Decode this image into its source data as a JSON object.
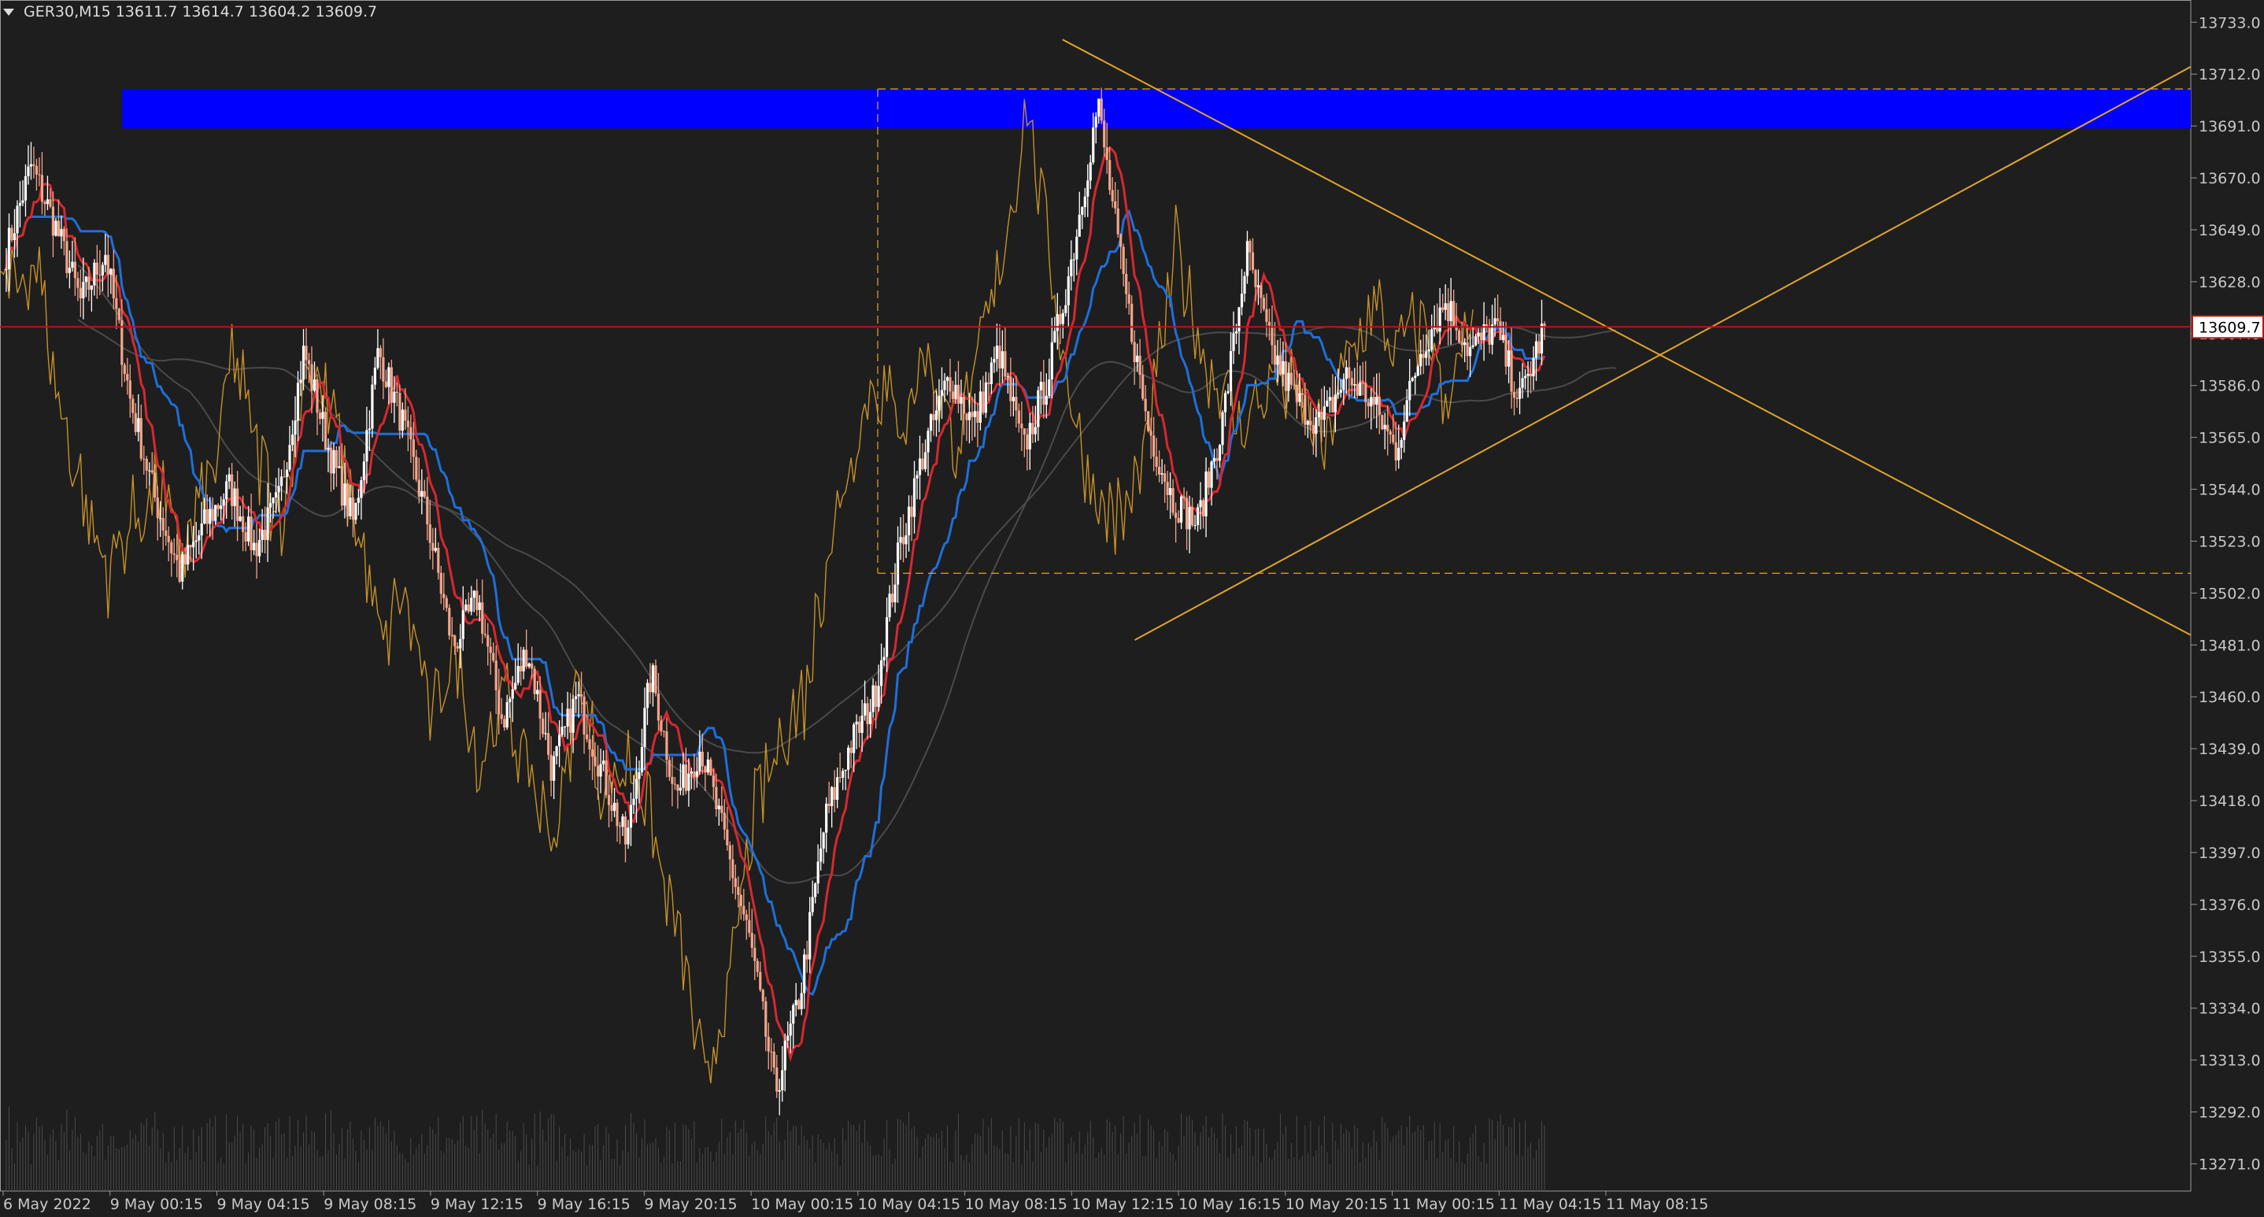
{
  "header": {
    "symbol_timeframe": "GER30,M15",
    "ohlc": "13611.7 13614.7 13604.2 13609.7"
  },
  "price_label": "13609.7",
  "colors": {
    "background": "#1e1e1e",
    "bull_candle": "#ffffff",
    "bear_candle": "#f4a58a",
    "zone": "#0000ff",
    "trendline": "#e2a52a",
    "tenkan": "#d6282f",
    "kijun": "#1e6fd9",
    "cloud_lines": "#4a4a4a",
    "chikou": "#e2a52a",
    "price_line": "#b01818",
    "grid_text": "#c8c8c8"
  },
  "chart_data": {
    "type": "candlestick",
    "symbol": "GER30",
    "timeframe": "M15",
    "ylim": [
      13260,
      13742
    ],
    "y_ticks": [
      13733.0,
      13712.0,
      13691.0,
      13670.0,
      13649.0,
      13628.0,
      13607.0,
      13586.0,
      13565.0,
      13544.0,
      13523.0,
      13502.0,
      13481.0,
      13460.0,
      13439.0,
      13418.0,
      13397.0,
      13376.0,
      13355.0,
      13334.0,
      13313.0,
      13292.0,
      13271.0
    ],
    "x_ticks": [
      "6 May 2022",
      "9 May 00:15",
      "9 May 04:15",
      "9 May 08:15",
      "9 May 12:15",
      "9 May 16:15",
      "9 May 20:15",
      "10 May 00:15",
      "10 May 04:15",
      "10 May 08:15",
      "10 May 12:15",
      "10 May 16:15",
      "10 May 20:15",
      "11 May 00:15",
      "11 May 04:15",
      "11 May 08:15"
    ],
    "last_price": 13609.7,
    "close_path": [
      13640,
      13675,
      13650,
      13620,
      13640,
      13580,
      13540,
      13510,
      13530,
      13545,
      13520,
      13540,
      13600,
      13560,
      13530,
      13600,
      13570,
      13530,
      13480,
      13500,
      13450,
      13480,
      13430,
      13460,
      13430,
      13400,
      13470,
      13420,
      13440,
      13400,
      13360,
      13300,
      13340,
      13410,
      13440,
      13460,
      13520,
      13560,
      13590,
      13570,
      13600,
      13560,
      13590,
      13640,
      13700,
      13630,
      13570,
      13540,
      13530,
      13570,
      13640,
      13600,
      13580,
      13570,
      13590,
      13580,
      13560,
      13600,
      13620,
      13600,
      13610,
      13580,
      13610
    ],
    "zones": [
      {
        "y_top": 13706,
        "y_bottom": 13690
      }
    ],
    "horizontal_levels": [
      13706,
      13510
    ],
    "trendlines": [
      {
        "from": [
          0.485,
          13726
        ],
        "to": [
          1.0,
          13485
        ]
      },
      {
        "from": [
          0.518,
          13483
        ],
        "to": [
          1.0,
          13715
        ]
      }
    ]
  }
}
